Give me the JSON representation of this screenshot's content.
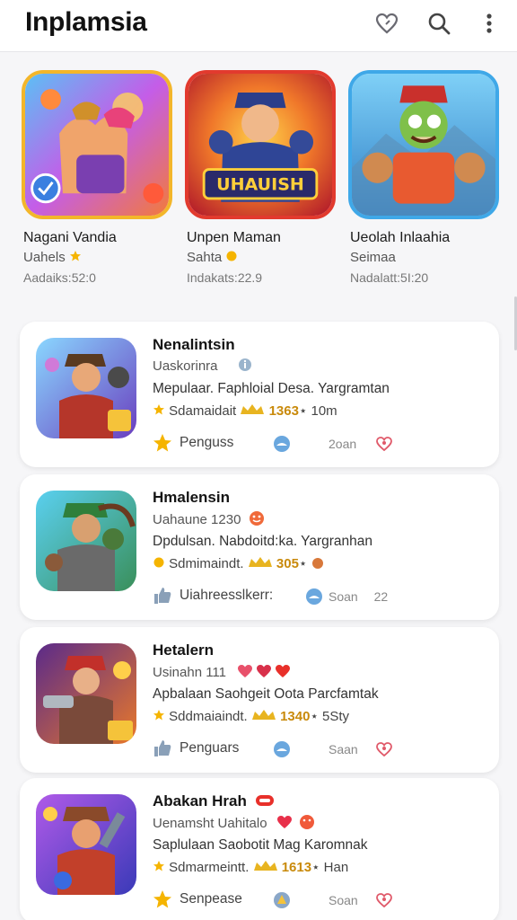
{
  "app": {
    "title": "Inplamsia"
  },
  "header_icons": [
    "heart-icon",
    "search-icon",
    "more-vertical-icon"
  ],
  "featured": [
    {
      "title": "Nagani Vandia",
      "subtitle": "Uahels",
      "meta": "Aadaiks:52:0"
    },
    {
      "title": "Unpen Maman",
      "subtitle": "Sahta",
      "meta": "Indakats:22.9",
      "banner_text": "UHAUISH"
    },
    {
      "title": "Ueolah Inlaahia",
      "subtitle": "Seimaa",
      "meta": "Nadalatt:5I:20"
    }
  ],
  "list": [
    {
      "title": "Nenalintsin",
      "developer": "Uaskorinra",
      "description": "Mepulaar. Faphloial Desa. Yargramtan",
      "rating_label": "Sdamaidait",
      "rating_value": "1363",
      "rating_extra": "10m",
      "action": "Penguss",
      "size": "2oan"
    },
    {
      "title": "Hmalensin",
      "developer": "Uahaune 1230",
      "description": "Dpdulsan. Nabdoitd:ka. Yargranhan",
      "rating_label": "Sdmimaindt.",
      "rating_value": "305",
      "rating_extra": "",
      "action": "Uiahreesslkerr:",
      "size": "Soan",
      "size_extra": "22"
    },
    {
      "title": "Hetalern",
      "developer": "Usinahn 111",
      "description": "Apbalaan Saohgeit Oota Parcfamtak",
      "rating_label": "Sddmaiaindt.",
      "rating_value": "1340",
      "rating_extra": "5Sty",
      "action": "Penguars",
      "size": "Saan"
    },
    {
      "title": "Abakan Hrah",
      "developer": "Uenamsht Uahitalo",
      "description": "Saplulaan Saobotit Mag Karomnak",
      "rating_label": "Sdmarmeintt.",
      "rating_value": "1613",
      "rating_extra": "Han",
      "action": "Senpease",
      "size": "Soan"
    }
  ],
  "colors": {
    "accent_star": "#f5b400",
    "heart": "#e05a6a",
    "badge_blue": "#5b9bd5"
  }
}
